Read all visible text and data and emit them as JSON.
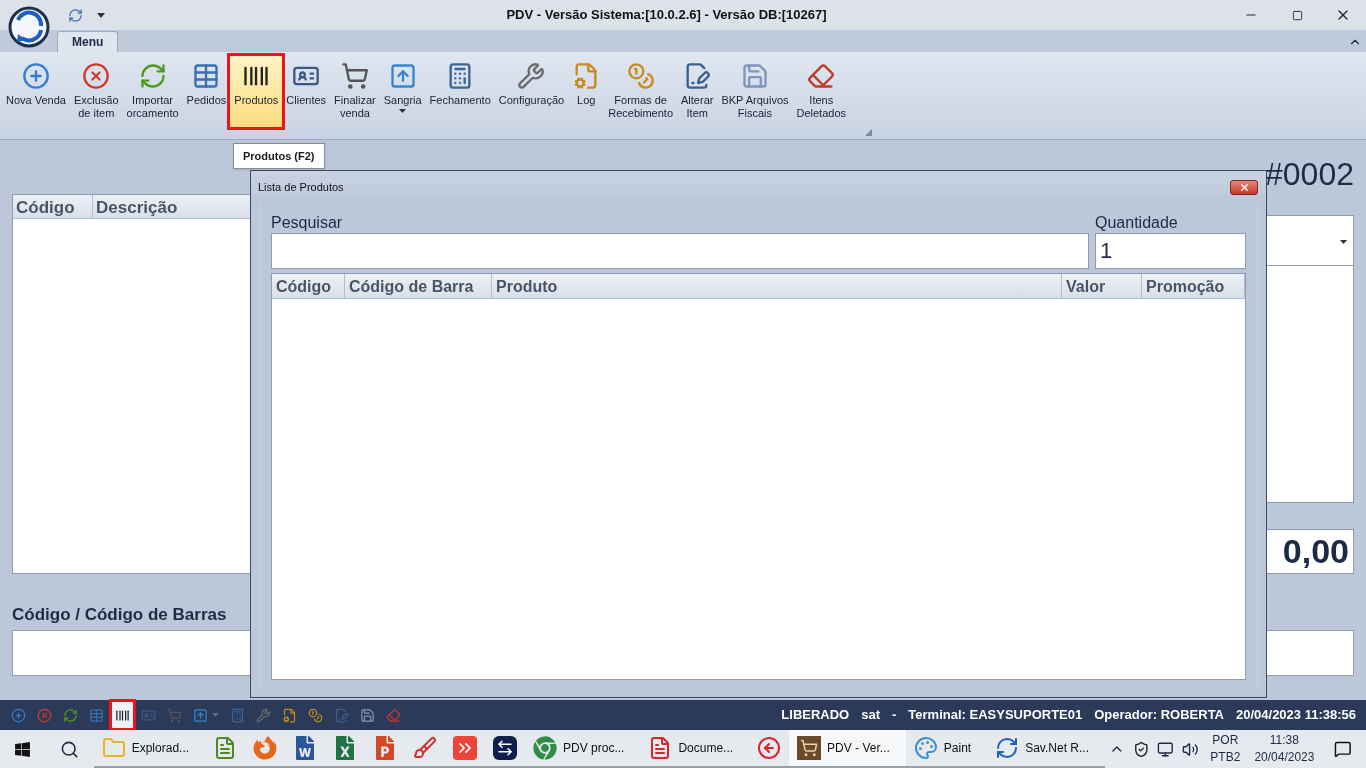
{
  "window": {
    "title": "PDV - Versão Sistema:[10.0.2.6] - Versão DB:[10267]"
  },
  "ribbon": {
    "tabs": [
      {
        "label": "Menu",
        "selected": true
      }
    ],
    "buttons": [
      {
        "kind": "add",
        "lines": [
          "Nova Venda"
        ],
        "selected": false,
        "dropdown": false
      },
      {
        "kind": "delete",
        "lines": [
          "Exclusão",
          "de item"
        ],
        "selected": false,
        "dropdown": false
      },
      {
        "kind": "refresh",
        "lines": [
          "Importar",
          "orcamento"
        ],
        "selected": false,
        "dropdown": false
      },
      {
        "kind": "grid",
        "lines": [
          "Pedidos"
        ],
        "selected": false,
        "dropdown": false
      },
      {
        "kind": "barcode",
        "lines": [
          "Produtos"
        ],
        "selected": true,
        "dropdown": false
      },
      {
        "kind": "card",
        "lines": [
          "Clientes"
        ],
        "selected": false,
        "dropdown": false
      },
      {
        "kind": "cart",
        "lines": [
          "Finalizar",
          "venda"
        ],
        "selected": false,
        "dropdown": false
      },
      {
        "kind": "upload",
        "lines": [
          "Sangria"
        ],
        "selected": false,
        "dropdown": true
      },
      {
        "kind": "calculator",
        "lines": [
          "Fechamento"
        ],
        "selected": false,
        "dropdown": false
      },
      {
        "kind": "tools",
        "lines": [
          "Configuração"
        ],
        "selected": false,
        "dropdown": false
      },
      {
        "kind": "log",
        "lines": [
          "Log"
        ],
        "selected": false,
        "dropdown": false
      },
      {
        "kind": "coins",
        "lines": [
          "Formas de",
          "Recebimento"
        ],
        "selected": false,
        "dropdown": false
      },
      {
        "kind": "edit",
        "lines": [
          "Alterar",
          "Item"
        ],
        "selected": false,
        "dropdown": false
      },
      {
        "kind": "save",
        "lines": [
          "BKP Arquivos",
          "Fiscais"
        ],
        "selected": false,
        "dropdown": false
      },
      {
        "kind": "eraser",
        "lines": [
          "Itens",
          "Deletados"
        ],
        "selected": false,
        "dropdown": false
      }
    ]
  },
  "tooltip": "Produtos (F2)",
  "main": {
    "caixa": "#0002",
    "left_table": {
      "columns": [
        "Código",
        "Descrição"
      ]
    },
    "total": "0,00",
    "barcode_label": "Código / Código de Barras"
  },
  "dialog": {
    "title": "Lista de Produtos",
    "search_label": "Pesquisar",
    "quantity_label": "Quantidade",
    "quantity_value": "1",
    "columns": [
      "Código",
      "Código de Barra",
      "Produto",
      "Valor",
      "Promoção"
    ]
  },
  "status_bar": {
    "icons": [
      {
        "kind": "add",
        "selected": false,
        "dropdown": false
      },
      {
        "kind": "delete",
        "selected": false,
        "dropdown": false
      },
      {
        "kind": "refresh",
        "selected": false,
        "dropdown": false
      },
      {
        "kind": "grid",
        "selected": false,
        "dropdown": false
      },
      {
        "kind": "barcode",
        "selected": true,
        "dropdown": false
      },
      {
        "kind": "card",
        "selected": false,
        "dropdown": false
      },
      {
        "kind": "cart",
        "selected": false,
        "dropdown": false
      },
      {
        "kind": "upload",
        "selected": false,
        "dropdown": true
      },
      {
        "kind": "calculator",
        "selected": false,
        "dropdown": false
      },
      {
        "kind": "tools",
        "selected": false,
        "dropdown": false
      },
      {
        "kind": "log",
        "selected": false,
        "dropdown": false
      },
      {
        "kind": "coins",
        "selected": false,
        "dropdown": false
      },
      {
        "kind": "edit",
        "selected": false,
        "dropdown": false
      },
      {
        "kind": "save",
        "selected": false,
        "dropdown": false
      },
      {
        "kind": "eraser",
        "selected": false,
        "dropdown": false
      }
    ],
    "texts": [
      "LIBERADO",
      "sat",
      "-",
      "Terminal: EASYSUPORTE01",
      "Operador: ROBERTA",
      "20/04/2023 11:38:56"
    ]
  },
  "taskbar": {
    "apps": [
      {
        "kind": "explorer",
        "label": "Explorad...",
        "selected": false
      },
      {
        "kind": "notepad",
        "selected": false
      },
      {
        "kind": "firefox",
        "selected": false
      },
      {
        "kind": "word",
        "selected": false
      },
      {
        "kind": "excel",
        "selected": false
      },
      {
        "kind": "powerpoint",
        "selected": false
      },
      {
        "kind": "ccleaner",
        "selected": false
      },
      {
        "kind": "anydesk",
        "selected": false
      },
      {
        "kind": "teamviewer",
        "selected": false
      },
      {
        "kind": "chrome",
        "label": "PDV proc...",
        "selected": false
      },
      {
        "kind": "wps",
        "label": "Docume...",
        "selected": false
      },
      {
        "kind": "cbrowser",
        "selected": false
      },
      {
        "kind": "pdv",
        "label": "PDV - Ver...",
        "selected": true
      },
      {
        "kind": "paint",
        "label": "Paint",
        "selected": false
      },
      {
        "kind": "savnet",
        "label": "Sav.Net R...",
        "selected": false
      }
    ],
    "language": [
      "POR",
      "PTB2"
    ],
    "time": "11:38",
    "date": "20/04/2023"
  }
}
